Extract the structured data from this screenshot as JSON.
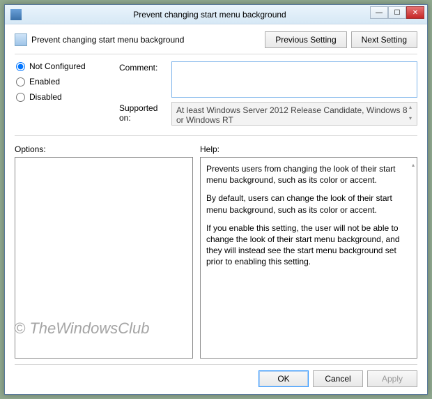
{
  "titlebar": {
    "title": "Prevent changing start menu background"
  },
  "header": {
    "policy_title": "Prevent changing start menu background",
    "prev_setting": "Previous Setting",
    "next_setting": "Next Setting"
  },
  "radios": {
    "not_configured": "Not Configured",
    "enabled": "Enabled",
    "disabled": "Disabled",
    "selected": "not_configured"
  },
  "fields": {
    "comment_label": "Comment:",
    "comment_value": "",
    "supported_label": "Supported on:",
    "supported_value": "At least Windows Server 2012 Release Candidate, Windows 8 or Windows RT"
  },
  "panels": {
    "options_label": "Options:",
    "help_label": "Help:",
    "help_paras": [
      "Prevents users from changing the look of their start menu background, such as its color or accent.",
      "By default, users can change the look of their start menu background, such as its color or accent.",
      "If you enable this setting, the user will not be able to change the look of their start menu background, and they will instead see the start menu background set prior to enabling this setting."
    ]
  },
  "footer": {
    "ok": "OK",
    "cancel": "Cancel",
    "apply": "Apply"
  },
  "watermark": "© TheWindowsClub"
}
